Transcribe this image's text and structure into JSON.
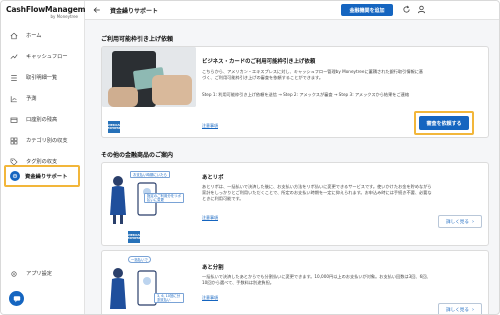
{
  "app": {
    "logo_main": "CashFlowManagement",
    "logo_sub": "by Moneytree"
  },
  "sidebar": {
    "items": [
      {
        "label": "ホーム",
        "icon": "home-icon"
      },
      {
        "label": "キャッシュフロー",
        "icon": "cashflow-icon"
      },
      {
        "label": "取引明細一覧",
        "icon": "list-icon"
      },
      {
        "label": "予測",
        "icon": "forecast-icon"
      },
      {
        "label": "口座別の残高",
        "icon": "account-icon"
      },
      {
        "label": "カテゴリ別の収支",
        "icon": "category-icon"
      },
      {
        "label": "タグ別の収支",
        "icon": "tag-icon"
      }
    ],
    "active_label": "資金繰りサポート",
    "settings_label": "アプリ設定"
  },
  "topbar": {
    "title": "資金繰りサポート",
    "add_button": "金融機関を追加"
  },
  "section1": {
    "title": "ご利用可能枠引き上げ依頼",
    "card_heading": "ビジネス・カードのご利用可能枠引き上げ依頼",
    "card_text": "こちらから、アメリカン・エキスプレスに対し、キャッシュフロー管理by Moneytreeに蓄積された銀行取引情報に基づく、ご利用可能枠引き上げの審査を依頼することができます。",
    "steps": "Step 1: 利用可能枠引き上げ依頼を送信 → Step 2: アメックスが審査 → Step 3: アメックスから結果をご連絡",
    "note_link": "注意事項",
    "apply_button": "審査を依頼する",
    "brand_label": "AMERICAN EXPRESS"
  },
  "section2": {
    "title": "その他の金融商品のご案内",
    "products": [
      {
        "name": "あとリボ",
        "text": "あとリボは、一括払いで決済した後に、お支払い方法をリボ払いに変更できるサービスです。使いかけたお金を貯めながら家計をしっかりとご利用いただくことで、所定のお支払い時期を一定に抑えられます。お申込み時には手続き不要、必要なときに利用可能です。",
        "note_link": "注意事項",
        "more_button": "詳しく見る",
        "badge1": "お支払い時期にいたら",
        "badge2": "指定のご利用分をリボ払いに変更",
        "brand_label": "AMERICAN EXPRESS"
      },
      {
        "name": "あと分割",
        "text": "一括払いで決済したあとからでも分割払いに変更できます。10,000円以上のお支払いが対象。お支払い回数は3回、6回、10回から選べて、手数料は別途負担。",
        "note_link": "注意事項",
        "more_button": "詳しく見る",
        "badge1": "一括払いで",
        "badge2": "3, 6, 10回に分割支払い"
      }
    ]
  },
  "colors": {
    "accent": "#1565c0",
    "highlight": "#f2b63a"
  }
}
